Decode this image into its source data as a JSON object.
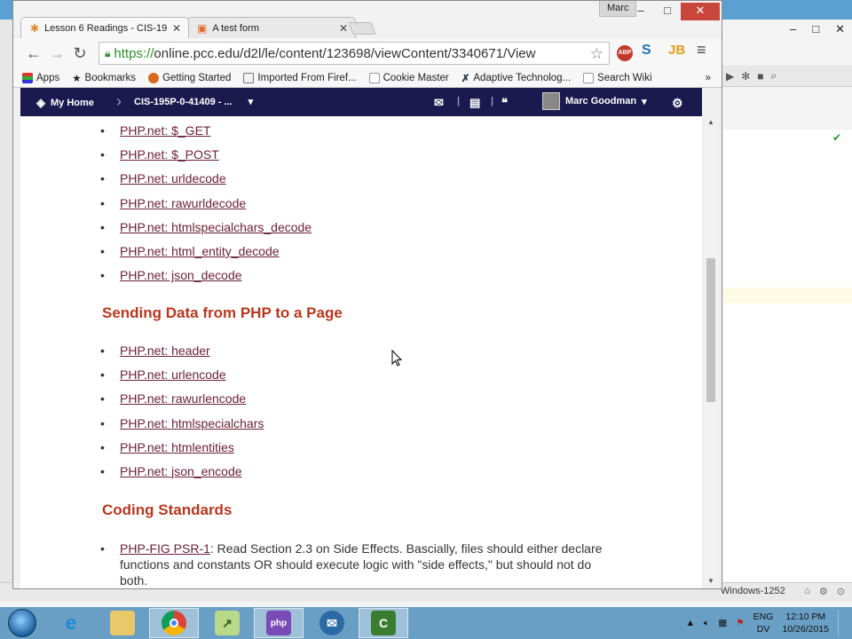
{
  "browser": {
    "tabs": [
      {
        "title": "Lesson 6 Readings - CIS-19",
        "active": true
      },
      {
        "title": "A test form",
        "active": false
      }
    ],
    "user_chip": "Marc",
    "window_controls": {
      "minimize": "–",
      "maximize": "□",
      "close": "✕"
    },
    "url_scheme": "https://",
    "url_rest": "online.pcc.edu/d2l/le/content/123698/viewContent/3340671/View",
    "nav": {
      "back": "←",
      "forward": "→",
      "reload": "↻"
    },
    "extensions": {
      "abp": "ABP",
      "jb": "JB",
      "menu": "≡"
    },
    "bookmarks": [
      "Apps",
      "Bookmarks",
      "Getting Started",
      "Imported From Firef...",
      "Cookie Master",
      "Adaptive Technolog...",
      "Search Wiki"
    ],
    "bookmarks_overflow": "»"
  },
  "d2l_nav": {
    "home": "My Home",
    "course": "CIS-195P-0-41409 - ...",
    "user": "Marc Goodman"
  },
  "content": {
    "receive_links": [
      "PHP.net: $_GET",
      "PHP.net: $_POST",
      "PHP.net: urldecode",
      "PHP.net: rawurldecode",
      "PHP.net: htmlspecialchars_decode",
      "PHP.net: html_entity_decode",
      "PHP.net: json_decode"
    ],
    "section_send": "Sending Data from PHP to a Page",
    "send_links": [
      "PHP.net: header",
      "PHP.net: urlencode",
      "PHP.net: rawurlencode",
      "PHP.net: htmlspecialchars",
      "PHP.net: htmlentities",
      "PHP.net: json_encode"
    ],
    "section_standards": "Coding Standards",
    "standards_link": "PHP-FIG PSR-1",
    "standards_text": ": Read Section 2.3 on Side Effects. Bascially, files should either declare functions and constants OR should execute logic with \"side effects,\" but should not do both."
  },
  "background_app": {
    "encoding": "Windows-1252"
  },
  "taskbar": {
    "lang_line1": "ENG",
    "lang_line2": "DV",
    "time": "12:10 PM",
    "date": "10/26/2015",
    "apps": [
      "ie",
      "explorer",
      "chrome",
      "notepad",
      "phpstorm",
      "thunderbird",
      "camtasia"
    ]
  },
  "colors": {
    "link": "#6b2236",
    "heading": "#b5391f",
    "navbar": "#1b1a4f"
  }
}
